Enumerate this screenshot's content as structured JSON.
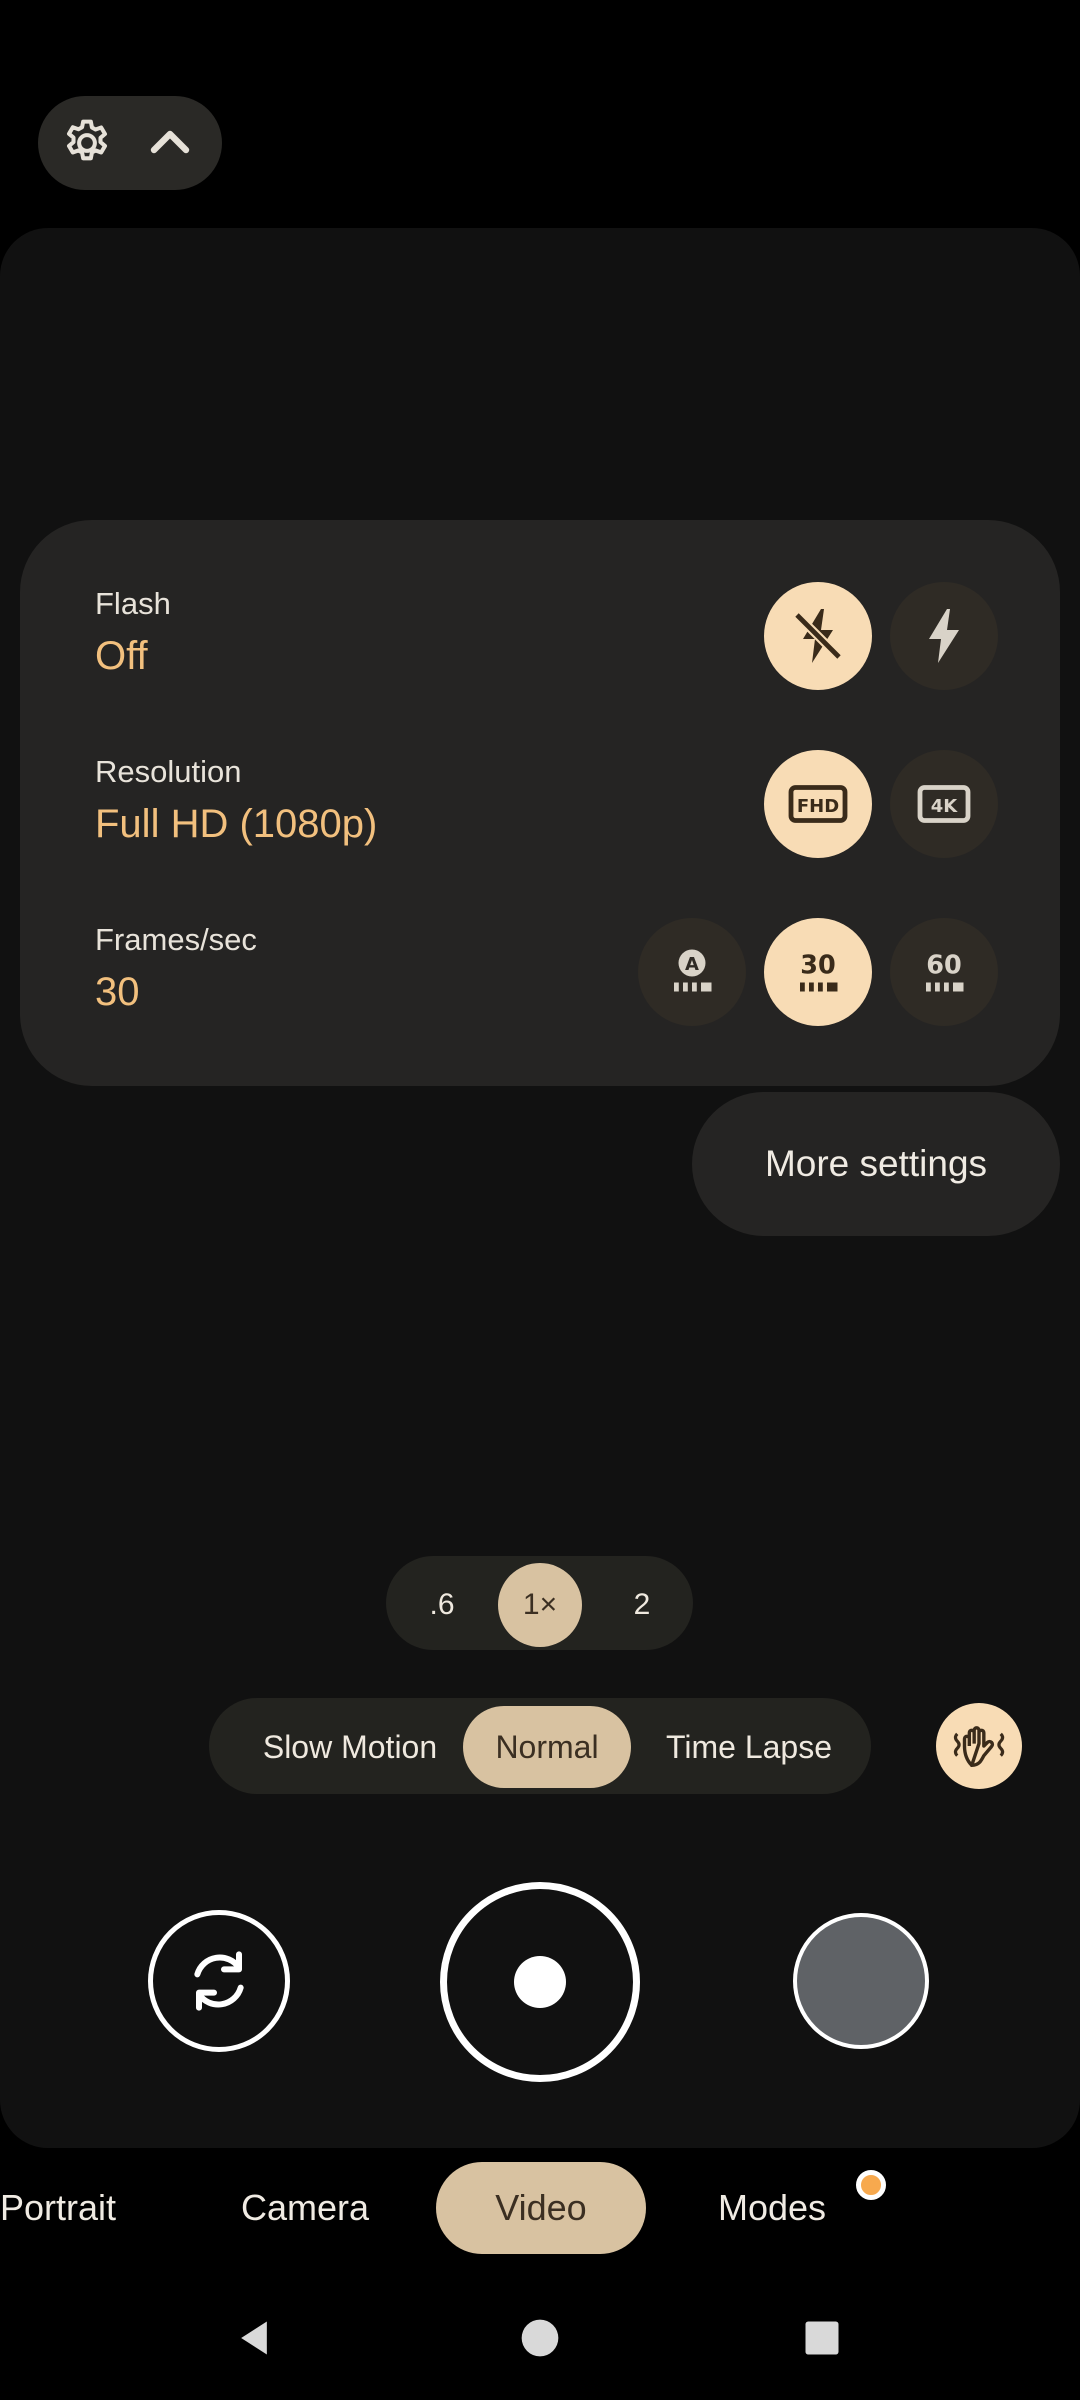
{
  "top_controls": {
    "settings_icon": "gear-icon",
    "collapse_icon": "chevron-up-icon"
  },
  "quick_settings": {
    "flash": {
      "label": "Flash",
      "value": "Off",
      "options": [
        "flash-off-icon",
        "flash-on-icon"
      ],
      "selected": 0
    },
    "resolution": {
      "label": "Resolution",
      "value": "Full HD (1080p)",
      "options": [
        {
          "icon": "fhd-icon",
          "text": "FHD"
        },
        {
          "icon": "4k-icon",
          "text": "4K"
        }
      ],
      "selected": 0
    },
    "fps": {
      "label": "Frames/sec",
      "value": "30",
      "options": [
        {
          "icon": "fps-auto-icon",
          "text": "A"
        },
        {
          "icon": "fps-30-icon",
          "text": "30"
        },
        {
          "icon": "fps-60-icon",
          "text": "60"
        }
      ],
      "selected": 1
    }
  },
  "more_settings_label": "More settings",
  "zoom": {
    "options": [
      ".6",
      "1×",
      "2"
    ],
    "selected": 1
  },
  "speed": {
    "options": [
      "Slow Motion",
      "Normal",
      "Time Lapse"
    ],
    "selected": 1
  },
  "stabilization_icon": "hand-stabilization-icon",
  "modes": {
    "items": [
      "Portrait",
      "Camera",
      "Video",
      "Modes"
    ],
    "selected": 2
  },
  "colors": {
    "accent": "#f2c07e",
    "selected_chip": "#d8c2a1",
    "option_selected": "#f8dcb5",
    "notification_dot": "#f7a94e"
  },
  "nav": {
    "back_icon": "back-triangle-icon",
    "home_icon": "home-circle-icon",
    "recents_icon": "recents-square-icon"
  }
}
